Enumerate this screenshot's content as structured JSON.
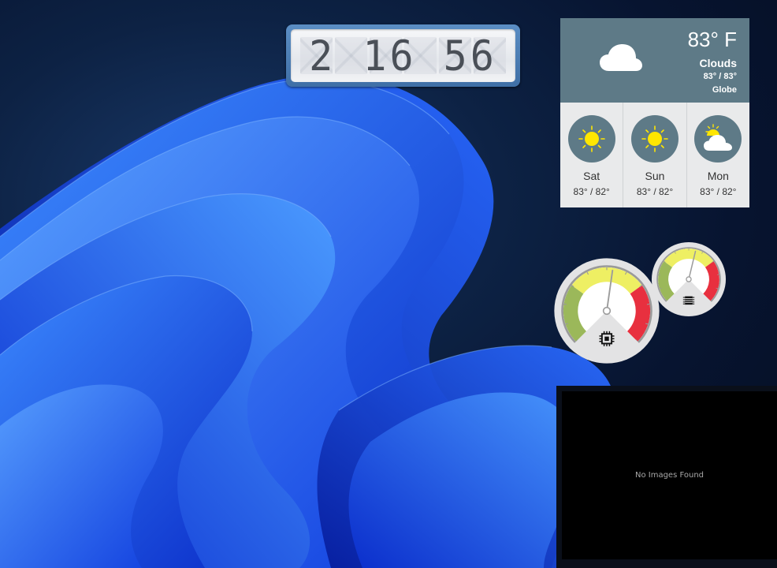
{
  "desktop": {
    "wallpaper": "windows-bloom",
    "colors": {
      "bloom_dark": "#0a2cc8",
      "bloom_mid": "#1a4ff0",
      "bloom_light": "#3b86ff"
    }
  },
  "clock": {
    "time_display": "2 16 56",
    "hours": "2",
    "minutes": "16",
    "seconds": "56",
    "colors": {
      "frame": "#4b7bb3",
      "digits": "#4a4f57"
    }
  },
  "weather": {
    "current": {
      "icon": "cloud-icon",
      "temperature": "83° F",
      "condition": "Clouds",
      "high_low": "83° / 83°",
      "location": "Globe"
    },
    "forecast": [
      {
        "day": "Sat",
        "icon": "sun-icon",
        "range": "83° / 82°"
      },
      {
        "day": "Sun",
        "icon": "sun-icon",
        "range": "83° / 82°"
      },
      {
        "day": "Mon",
        "icon": "partly-cloudy-icon",
        "range": "83° / 82°"
      }
    ],
    "colors": {
      "header": "#5e7a87",
      "body": "#e9eaeb",
      "sun": "#ffe600"
    }
  },
  "gauges": [
    {
      "name": "cpu",
      "icon": "cpu-chip-icon",
      "value_fraction": 0.53
    },
    {
      "name": "ram",
      "icon": "memory-icon",
      "value_fraction": 0.55
    }
  ],
  "gauge_colors": {
    "green": "#9bb85a",
    "yellow": "#eeef63",
    "red": "#e8303f",
    "face": "#e3e3e4",
    "rim": "#9a9a9a"
  },
  "picture_frame": {
    "message": "No Images Found"
  }
}
